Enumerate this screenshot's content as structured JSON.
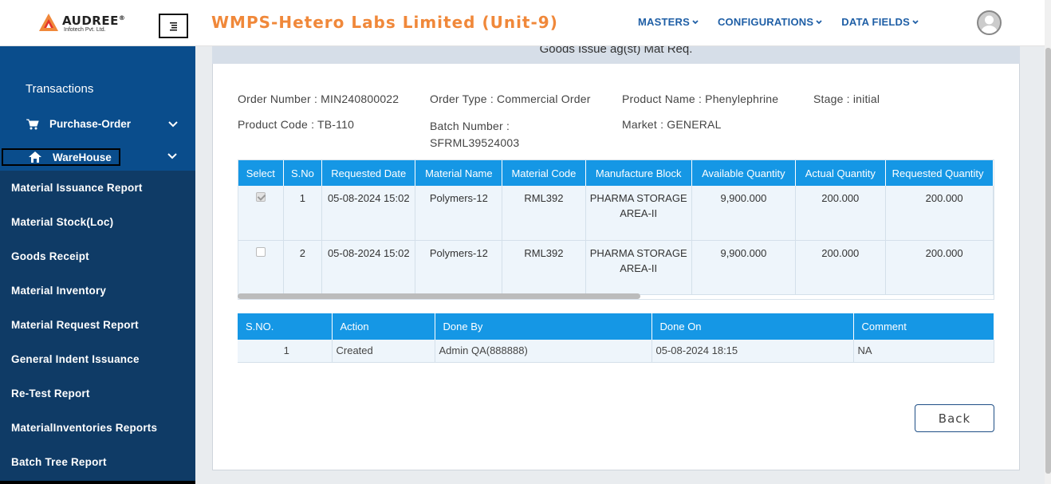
{
  "header": {
    "logo_name": "AUDREE",
    "logo_registered": "®",
    "logo_sub": "Infotech Pvt. Ltd.",
    "app_title": "WMPS-Hetero Labs Limited (Unit-9)",
    "nav": [
      "MASTERS",
      "CONFIGURATIONS",
      "DATA FIELDS"
    ]
  },
  "sidebar": {
    "section": "Transactions",
    "purchase_order": "Purchase-Order",
    "warehouse": "WareHouse",
    "links": [
      "Material Issuance Report",
      "Material Stock(Loc)",
      "Goods Receipt",
      "Material Inventory",
      "Material Request Report",
      "General Indent Issuance",
      "Re-Test Report",
      "MaterialInventories Reports",
      "Batch Tree Report"
    ]
  },
  "page": {
    "card_title": "Goods Issue ag(st) Mat Req.",
    "order_number": "Order Number : MIN240800022",
    "order_type": "Order Type : Commercial Order",
    "product_name": "Product Name : Phenylephrine",
    "stage": "Stage : initial",
    "product_code": "Product Code : TB-110",
    "batch_number_label": "Batch Number :",
    "batch_number_value": "SFRML39524003",
    "market": "Market : GENERAL",
    "back": "Back"
  },
  "materials_table": {
    "headers": [
      "Select",
      "S.No",
      "Requested Date",
      "Material Name",
      "Material Code",
      "Manufacture Block",
      "Available Quantity",
      "Actual Quantity",
      "Requested Quantity"
    ],
    "rows": [
      {
        "checked": true,
        "sno": "1",
        "date": "05-08-2024 15:02",
        "name": "Polymers-12",
        "code": "RML392",
        "block": "PHARMA STORAGE AREA-II",
        "available": "9,900.000",
        "actual": "200.000",
        "requested": "200.000"
      },
      {
        "checked": false,
        "sno": "2",
        "date": "05-08-2024 15:02",
        "name": "Polymers-12",
        "code": "RML392",
        "block": "PHARMA STORAGE AREA-II",
        "available": "9,900.000",
        "actual": "200.000",
        "requested": "200.000"
      }
    ]
  },
  "history_table": {
    "headers": [
      "S.NO.",
      "Action",
      "Done By",
      "Done On",
      "Comment"
    ],
    "rows": [
      {
        "sno": "1",
        "action": "Created",
        "by": "Admin QA(888888)",
        "on": "05-08-2024 18:15",
        "comment": "NA"
      }
    ]
  },
  "colors": {
    "title_orange": "#f0883a",
    "nav_blue": "#1f5fa6",
    "table_header": "#1597e5",
    "sidebar_dark": "#0f3b66",
    "sidebar_light": "#0a4d8c"
  }
}
